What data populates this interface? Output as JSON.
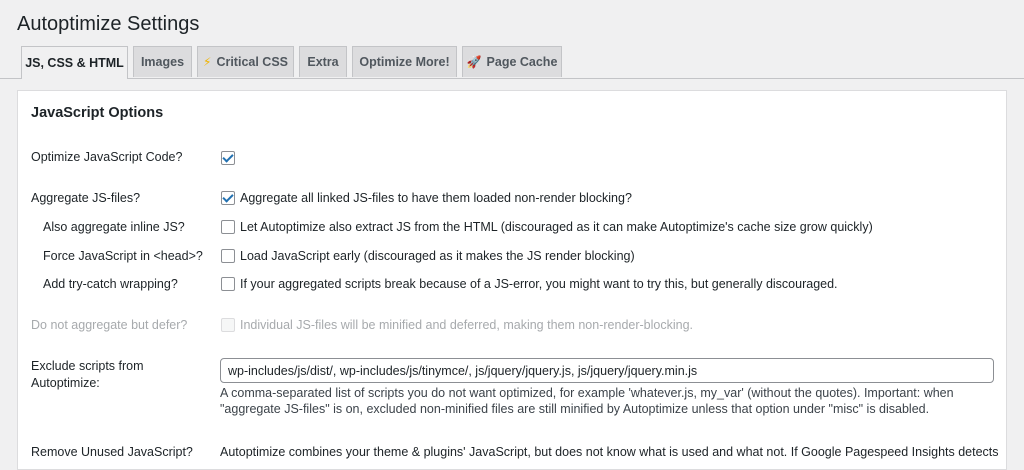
{
  "page": {
    "title": "Autoptimize Settings"
  },
  "tabs": [
    {
      "label": "JS, CSS & HTML",
      "icon": ""
    },
    {
      "label": "Images",
      "icon": ""
    },
    {
      "label": "Critical CSS",
      "icon": "⚡"
    },
    {
      "label": "Extra",
      "icon": ""
    },
    {
      "label": "Optimize More!",
      "icon": ""
    },
    {
      "label": "Page Cache",
      "icon": "🚀"
    }
  ],
  "section": {
    "title": "JavaScript Options"
  },
  "options": {
    "optimize_js": {
      "label": "Optimize JavaScript Code?",
      "checked": true
    },
    "aggregate_js": {
      "label": "Aggregate JS-files?",
      "desc": "Aggregate all linked JS-files to have them loaded non-render blocking?",
      "checked": true
    },
    "aggregate_inline": {
      "label": "Also aggregate inline JS?",
      "desc": "Let Autoptimize also extract JS from the HTML (discouraged as it can make Autoptimize's cache size grow quickly)",
      "checked": false
    },
    "force_head": {
      "label": "Force JavaScript in <head>?",
      "desc": "Load JavaScript early (discouraged as it makes the JS render blocking)",
      "checked": false
    },
    "try_catch": {
      "label": "Add try-catch wrapping?",
      "desc": "If your aggregated scripts break because of a JS-error, you might want to try this, but generally discouraged.",
      "checked": false
    },
    "defer": {
      "label": "Do not aggregate but defer?",
      "desc": "Individual JS-files will be minified and deferred, making them non-render-blocking.",
      "checked": false,
      "disabled": true
    },
    "exclude": {
      "label_line1": "Exclude scripts from",
      "label_line2": "Autoptimize:",
      "value": "wp-includes/js/dist/, wp-includes/js/tinymce/, js/jquery/jquery.js, js/jquery/jquery.min.js",
      "help": "A comma-separated list of scripts you do not want optimized, for example 'whatever.js, my_var' (without the quotes). Important: when \"aggregate JS-files\" is on, excluded non-minified files are still minified by Autoptimize unless that option under \"misc\" is disabled."
    },
    "remove_unused": {
      "label": "Remove Unused JavaScript?",
      "desc": "Autoptimize combines your theme & plugins' JavaScript, but does not know what is used and what not. If Google Pagespeed Insights detects"
    }
  },
  "colors": {
    "accent": "#2271b1",
    "disabled": "#a7aaad",
    "background": "#f0f0f1"
  }
}
